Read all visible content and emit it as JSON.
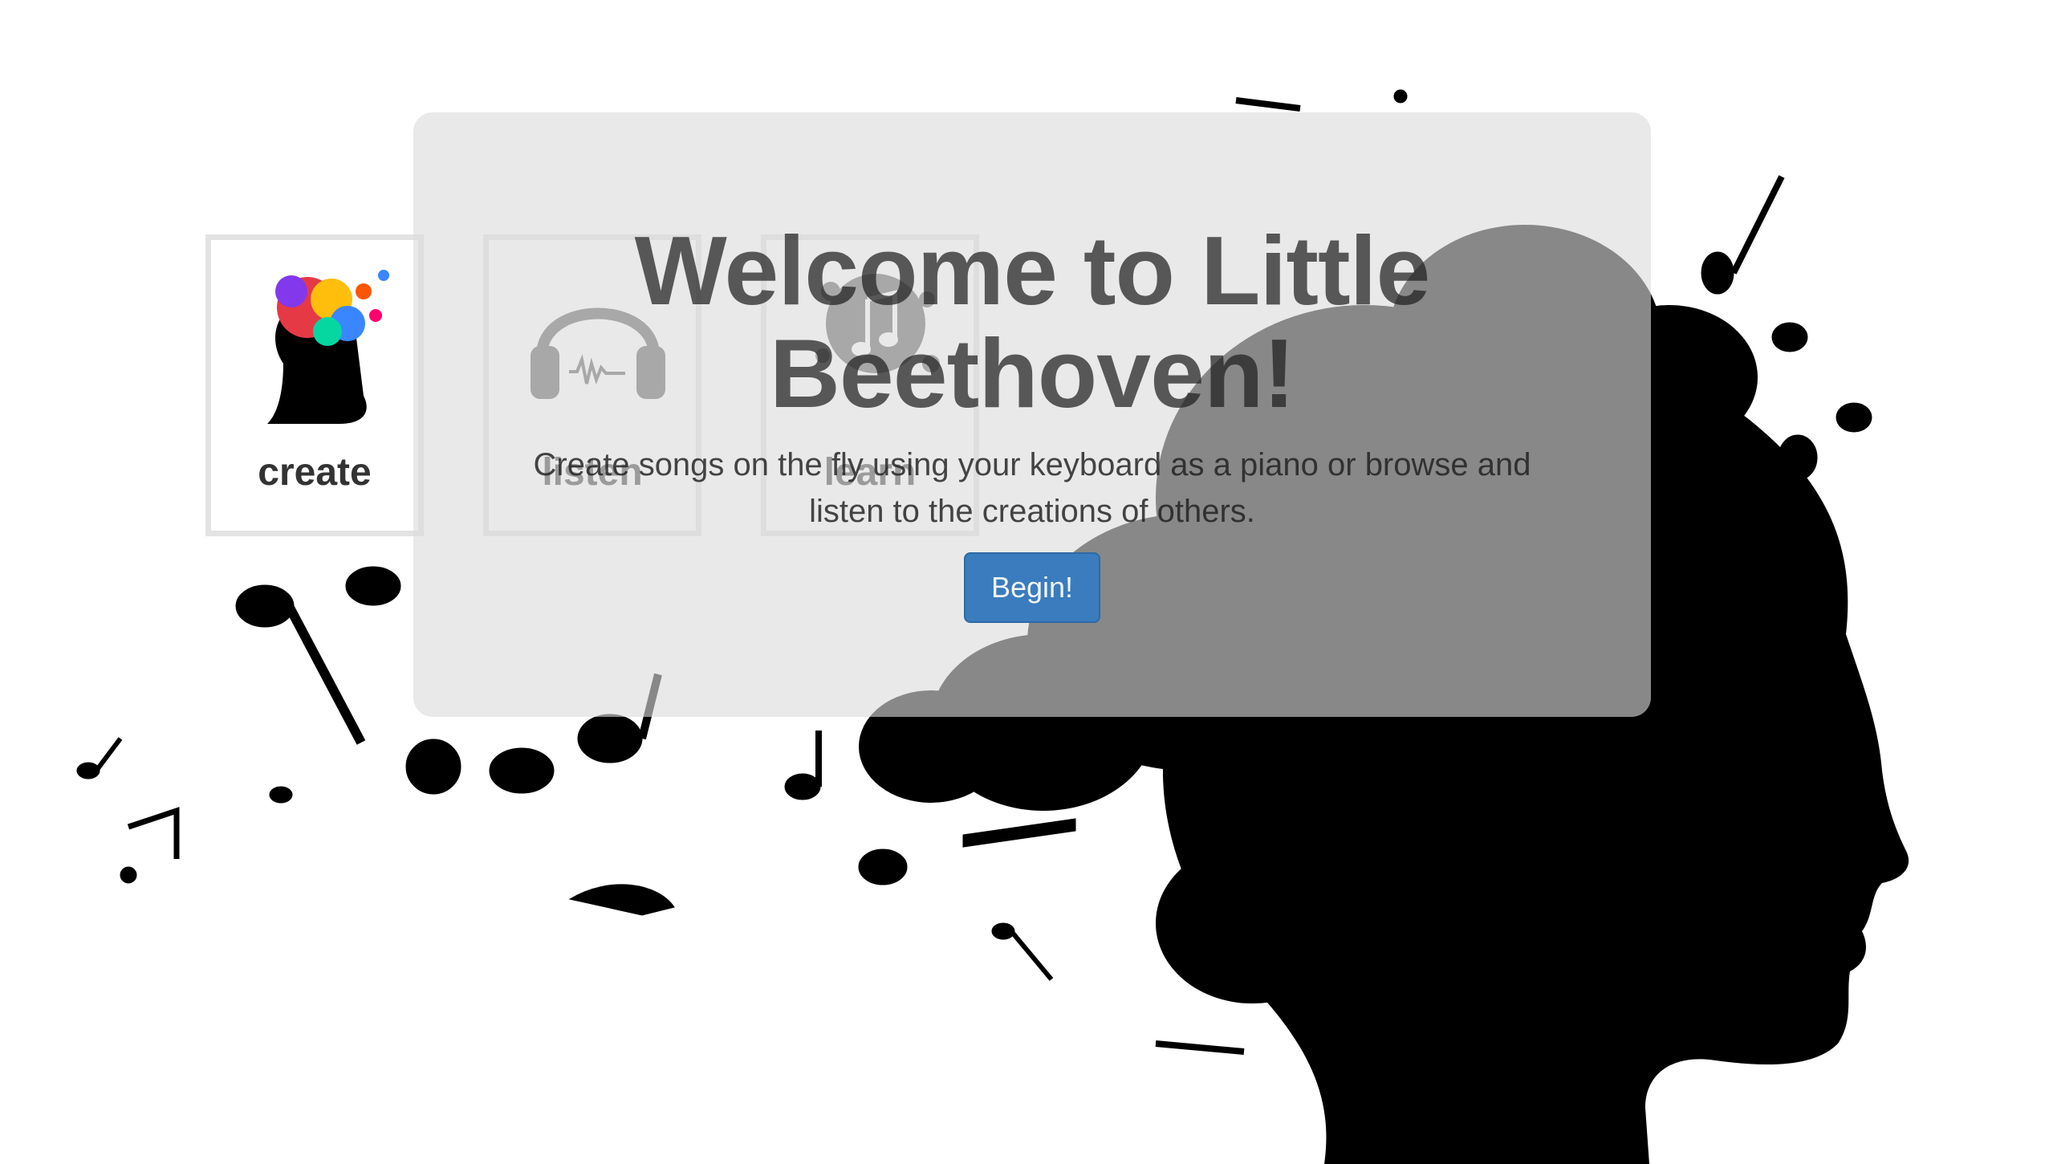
{
  "nav_tiles": [
    {
      "label": "create",
      "icon": "colorful-head-music-icon"
    },
    {
      "label": "listen",
      "icon": "headphones-icon"
    },
    {
      "label": "learn",
      "icon": "note-splash-icon"
    }
  ],
  "welcome": {
    "title": "Welcome to Little Beethoven!",
    "subtitle": "Create songs on the fly using your keyboard as a piano or browse and listen to the creations of others.",
    "button_label": "Begin!"
  },
  "background": {
    "art": "head-silhouette-with-music-notes"
  },
  "colors": {
    "button": "#3a7cbd",
    "overlay": "#dbdbdb",
    "tile_border": "#e3e3e3",
    "silhouette": "#000000"
  }
}
